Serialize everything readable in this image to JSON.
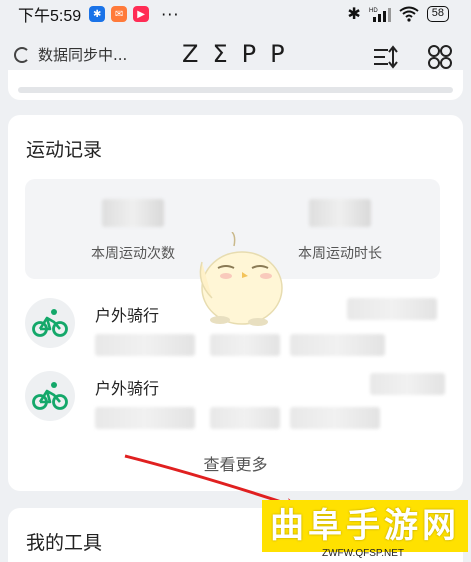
{
  "status_bar": {
    "time": "下午5:59",
    "battery": "58",
    "more_dots": "···"
  },
  "header": {
    "sync_text": "数据同步中...",
    "logo": "ZΣPP"
  },
  "workout_records": {
    "title": "运动记录",
    "weekly_count_label": "本周运动次数",
    "weekly_duration_label": "本周运动时长",
    "activities": [
      {
        "name": "户外骑行",
        "icon": "bicycle-icon"
      },
      {
        "name": "户外骑行",
        "icon": "bicycle-icon"
      }
    ],
    "view_more": "查看更多"
  },
  "my_tools": {
    "title": "我的工具"
  },
  "watermark": {
    "text": "曲阜手游网",
    "url": "ZWFW.QFSP.NET"
  },
  "colors": {
    "accent_green": "#14a86a",
    "arrow_red": "#e02020",
    "watermark_yellow": "#ffe100"
  }
}
